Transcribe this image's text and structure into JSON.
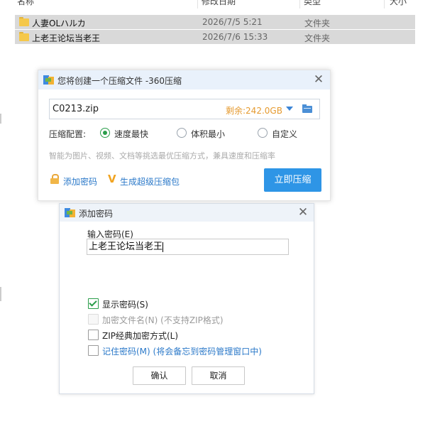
{
  "explorer": {
    "columns": [
      "名称",
      "修改日期",
      "类型",
      "大小"
    ],
    "files": [
      {
        "name": "人妻OLハルカ",
        "date": "2026/7/5 5:21",
        "type": "文件夹"
      },
      {
        "name": "上老王论坛当老王",
        "date": "2026/7/6 15:33",
        "type": "文件夹"
      }
    ]
  },
  "compress_dialog": {
    "title": "您将创建一个压缩文件 -360压缩",
    "file_name": "C0213.zip",
    "free_space": "剩余:242.0GB",
    "level_label": "压缩配置:",
    "options": [
      {
        "label": "速度最快",
        "selected": true
      },
      {
        "label": "体积最小",
        "selected": false
      },
      {
        "label": "自定义",
        "selected": false
      }
    ],
    "description": "智能为图片、视频、文档等挑选最优压缩方式，兼具速度和压缩率",
    "add_password": "添加密码",
    "super_pack": "生成超级压缩包",
    "compress_button": "立即压缩",
    "accent_color": "#2e95e6"
  },
  "password_dialog": {
    "title": "添加密码",
    "input_label": "输入密码(E)",
    "password_value": "上老王论坛当老王",
    "options": [
      {
        "label": "显示密码(S)",
        "checked": true,
        "enabled": true
      },
      {
        "label": "加密文件名(N) (不支持ZIP格式)",
        "checked": false,
        "enabled": false
      },
      {
        "label": "ZIP经典加密方式(L)",
        "checked": false,
        "enabled": true
      },
      {
        "label": "记住密码(M) (将会备忘到密码管理窗口中)",
        "checked": false,
        "enabled": true
      }
    ],
    "ok_button": "确认",
    "cancel_button": "取消"
  }
}
